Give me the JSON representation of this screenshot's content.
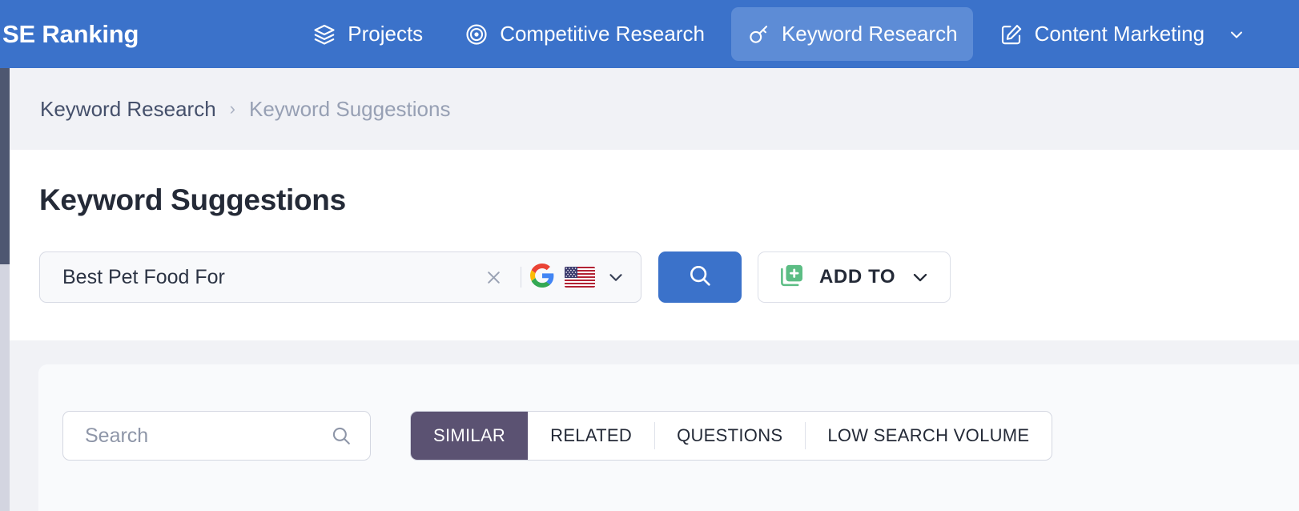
{
  "brand": "SE Ranking",
  "nav": {
    "items": [
      {
        "label": "Projects",
        "icon": "layers-icon",
        "active": false,
        "caret": false
      },
      {
        "label": "Competitive Research",
        "icon": "target-icon",
        "active": false,
        "caret": false
      },
      {
        "label": "Keyword Research",
        "icon": "key-icon",
        "active": true,
        "caret": false
      },
      {
        "label": "Content Marketing",
        "icon": "pencil-square-icon",
        "active": false,
        "caret": true
      }
    ]
  },
  "breadcrumb": {
    "parent": "Keyword Research",
    "separator": "›",
    "current": "Keyword Suggestions"
  },
  "page": {
    "title": "Keyword Suggestions"
  },
  "keyword_search": {
    "value": "Best Pet Food For",
    "clear_icon": "close-icon",
    "engine_icon": "google-icon",
    "country_icon": "us-flag-icon",
    "country_caret_icon": "chevron-down-icon",
    "search_button_icon": "search-icon",
    "add_to_label": "ADD TO",
    "add_to_icon": "add-to-list-icon",
    "add_to_caret_icon": "chevron-down-icon"
  },
  "filters": {
    "search_placeholder": "Search",
    "search_value": "",
    "search_icon": "search-icon",
    "tabs": [
      {
        "label": "SIMILAR",
        "active": true
      },
      {
        "label": "RELATED",
        "active": false
      },
      {
        "label": "QUESTIONS",
        "active": false
      },
      {
        "label": "LOW SEARCH VOLUME",
        "active": false
      }
    ]
  },
  "colors": {
    "nav_blue": "#3b72ca",
    "nav_active_blue": "#5d8cd6",
    "primary_button": "#3b72ca",
    "tab_active": "#5b5272",
    "accent_green": "#5cbd84",
    "sidebar_dark": "#4e5771",
    "page_gray": "#f1f2f6"
  }
}
